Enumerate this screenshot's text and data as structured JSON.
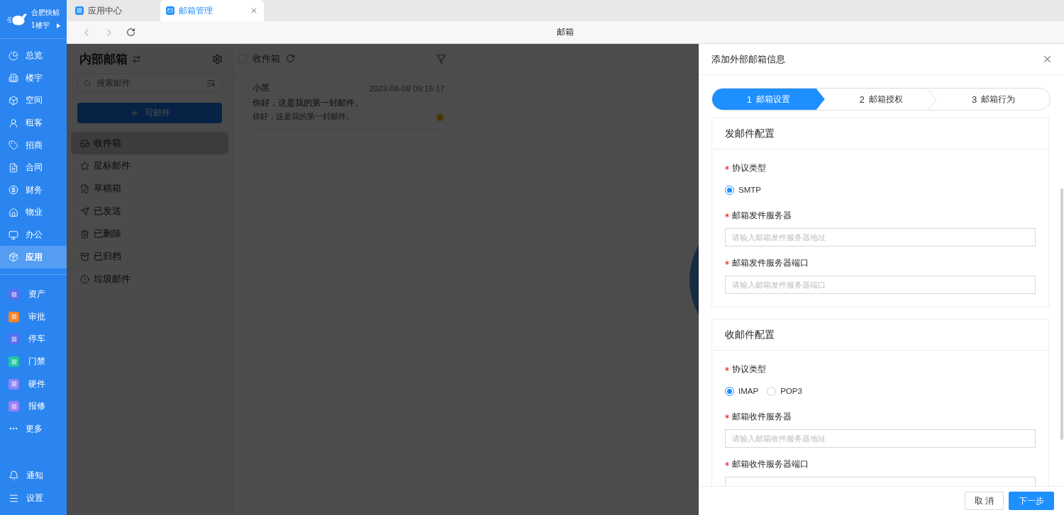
{
  "sidebar": {
    "brand": {
      "name": "合肥快鲸",
      "building": "1楼宇"
    },
    "nav_items": [
      {
        "label": "总览",
        "selected": false
      },
      {
        "label": "楼宇",
        "selected": false
      },
      {
        "label": "空间",
        "selected": false
      },
      {
        "label": "租客",
        "selected": false
      },
      {
        "label": "招商",
        "selected": false
      },
      {
        "label": "合同",
        "selected": false
      },
      {
        "label": "财务",
        "selected": false
      },
      {
        "label": "物业",
        "selected": false
      },
      {
        "label": "办公",
        "selected": false
      },
      {
        "label": "应用",
        "selected": true
      }
    ],
    "app_items": [
      {
        "label": "资产",
        "color": "#5b6cf0"
      },
      {
        "label": "审批",
        "color": "#f5822a"
      },
      {
        "label": "停车",
        "color": "#5a6df2"
      },
      {
        "label": "门禁",
        "color": "#1ec8a0"
      },
      {
        "label": "硬件",
        "color": "#8b86f5"
      },
      {
        "label": "报修",
        "color": "#9a7df5"
      }
    ],
    "more": "更多",
    "bottom_items": [
      {
        "label": "通知"
      },
      {
        "label": "设置"
      }
    ]
  },
  "tabs": [
    {
      "label": "应用中心",
      "selected": false
    },
    {
      "label": "邮箱管理",
      "selected": true
    }
  ],
  "address_title": "邮箱",
  "mailbox": {
    "title": "内部邮箱",
    "search": {
      "placeholder": "搜索邮件"
    },
    "compose": "写邮件",
    "folders": [
      {
        "label": "收件箱",
        "selected": true
      },
      {
        "label": "星标邮件",
        "selected": false
      },
      {
        "label": "草稿箱",
        "selected": false
      },
      {
        "label": "已发送",
        "selected": false
      },
      {
        "label": "已删除",
        "selected": false
      },
      {
        "label": "已归档",
        "selected": false
      },
      {
        "label": "垃圾邮件",
        "selected": false
      }
    ]
  },
  "message_list": {
    "folder": "收件箱",
    "select_all_checked": false,
    "messages": [
      {
        "sender": "小黑",
        "time": "2023-08-08 09:15:17",
        "subject": "你好，这是我的第一封邮件。",
        "preview": "你好，这是我的第一封邮件。",
        "starred": true
      }
    ]
  },
  "drawer": {
    "title": "添加外部邮箱信息",
    "steps": [
      {
        "number": "1",
        "label": "邮箱设置",
        "selected": true
      },
      {
        "number": "2",
        "label": "邮箱授权",
        "selected": false
      },
      {
        "number": "3",
        "label": "邮箱行为",
        "selected": false
      }
    ],
    "sections": [
      {
        "title": "发邮件配置",
        "fields": [
          {
            "kind": "radio",
            "label": "协议类型",
            "required": true,
            "options": [
              {
                "label": "SMTP",
                "selected": true
              }
            ]
          },
          {
            "kind": "input",
            "label": "邮箱发件服务器",
            "required": true,
            "placeholder": "请输入邮箱发件服务器地址"
          },
          {
            "kind": "input",
            "label": "邮箱发件服务器端口",
            "required": true,
            "placeholder": "请输入邮箱发件服务器端口"
          }
        ]
      },
      {
        "title": "收邮件配置",
        "fields": [
          {
            "kind": "radio",
            "label": "协议类型",
            "required": true,
            "options": [
              {
                "label": "IMAP",
                "selected": true
              },
              {
                "label": "POP3",
                "selected": false
              }
            ]
          },
          {
            "kind": "input",
            "label": "邮箱收件服务器",
            "required": true,
            "placeholder": "请输入邮箱收件服务器地址"
          },
          {
            "kind": "input",
            "label": "邮箱收件服务器端口",
            "required": true
          }
        ]
      }
    ],
    "buttons": [
      {
        "label": "取 消",
        "kind": "default"
      },
      {
        "label": "下一步",
        "kind": "primary"
      }
    ]
  }
}
